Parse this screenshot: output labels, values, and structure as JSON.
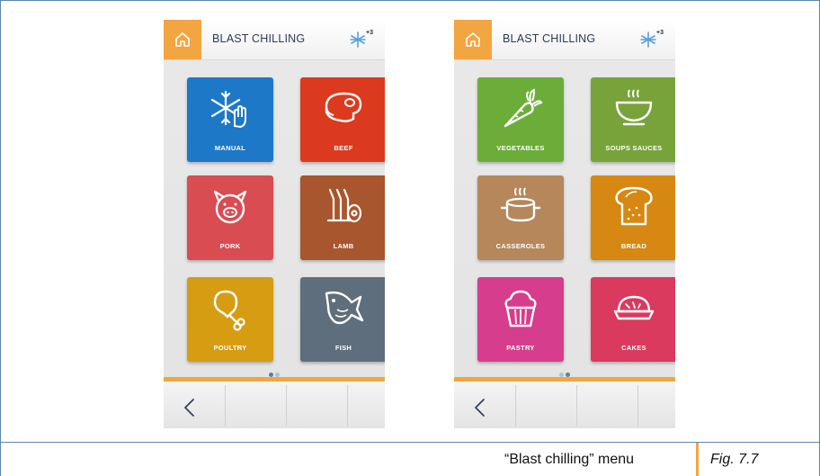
{
  "screens": [
    {
      "title": "BLAST CHILLING",
      "mode_badge": "+3",
      "tiles": [
        {
          "label": "MANUAL",
          "icon": "snowflake-hand-icon",
          "color": "#1e78c8"
        },
        {
          "label": "BEEF",
          "icon": "steak-icon",
          "color": "#dc3a1e"
        },
        {
          "label": "PORK",
          "icon": "pig-icon",
          "color": "#d84c52"
        },
        {
          "label": "LAMB",
          "icon": "lamb-ribs-icon",
          "color": "#a7562d"
        },
        {
          "label": "POULTRY",
          "icon": "drumstick-icon",
          "color": "#d69d12"
        },
        {
          "label": "FISH",
          "icon": "fish-icon",
          "color": "#5f6e7c"
        }
      ],
      "active_page": 0
    },
    {
      "title": "BLAST CHILLING",
      "mode_badge": "+3",
      "tiles": [
        {
          "label": "VEGETABLES",
          "icon": "carrot-icon",
          "color": "#6cad3a"
        },
        {
          "label": "SOUPS SAUCES",
          "icon": "soup-bowl-icon",
          "color": "#78a33a"
        },
        {
          "label": "CASSEROLES",
          "icon": "casserole-pot-icon",
          "color": "#b5875a"
        },
        {
          "label": "BREAD",
          "icon": "bread-icon",
          "color": "#d68812"
        },
        {
          "label": "PASTRY",
          "icon": "cupcake-icon",
          "color": "#d63d8c"
        },
        {
          "label": "CAKES",
          "icon": "pie-icon",
          "color": "#da3a5e"
        }
      ],
      "active_page": 1
    }
  ],
  "caption": {
    "text": "“Blast chilling” menu",
    "fig": "Fig. 7.7"
  },
  "colors": {
    "accent": "#f2a540",
    "border": "#5b87ad",
    "dot_active": "#5f7f96",
    "dot_inactive": "#a9c2d4"
  }
}
